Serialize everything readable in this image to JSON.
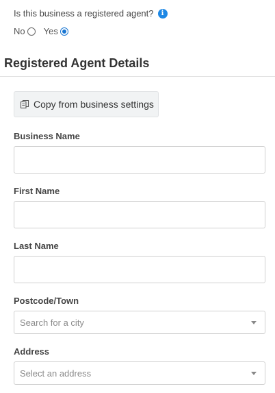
{
  "question": {
    "text": "Is this business a registered agent?",
    "info_icon": "info-icon",
    "options": [
      {
        "label": "No",
        "selected": false
      },
      {
        "label": "Yes",
        "selected": true
      }
    ]
  },
  "section": {
    "title": "Registered Agent Details"
  },
  "copy_button": {
    "label": "Copy from business settings",
    "icon": "copy-icon"
  },
  "fields": {
    "business_name": {
      "label": "Business Name",
      "value": ""
    },
    "first_name": {
      "label": "First Name",
      "value": ""
    },
    "last_name": {
      "label": "Last Name",
      "value": ""
    },
    "postcode_town": {
      "label": "Postcode/Town",
      "placeholder": "Search for a city"
    },
    "address": {
      "label": "Address",
      "placeholder": "Select an address"
    }
  },
  "colors": {
    "accent": "#1976d2",
    "info_icon": "#1e88e5",
    "button_bg": "#f1f3f4",
    "input_border": "#cfcfcf"
  }
}
